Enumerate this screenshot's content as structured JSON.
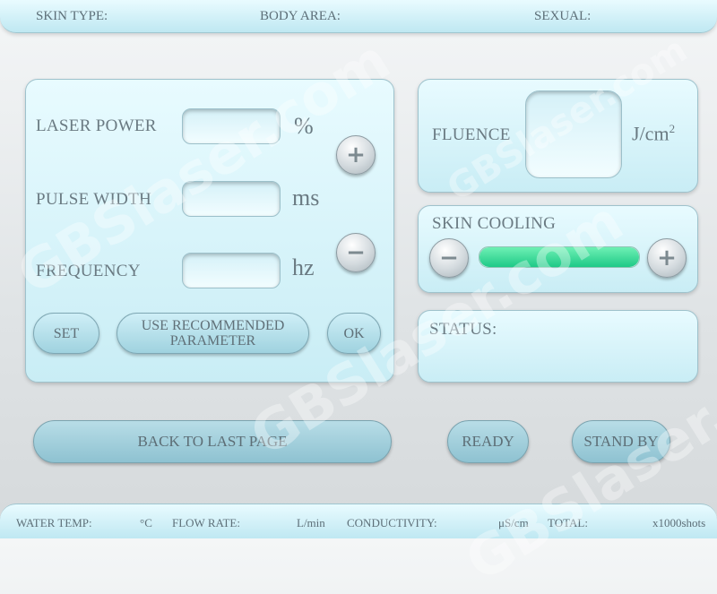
{
  "header": {
    "skin_type": "SKIN TYPE:",
    "body_area": "BODY AREA:",
    "sexual": "SEXUAL:"
  },
  "laser_panel": {
    "laser_power_label": "LASER POWER",
    "laser_power_unit": "%",
    "pulse_width_label": "PULSE  WIDTH",
    "pulse_width_unit": "ms",
    "frequency_label": "FREQUENCY",
    "frequency_unit": "hz",
    "plus_symbol": "+",
    "minus_symbol": "−",
    "set_label": "SET",
    "recommended_label": "USE  RECOMMENDED PARAMETER",
    "ok_label": "OK"
  },
  "fluence": {
    "label": "FLUENCE",
    "unit": "J/cm",
    "unit_exp": "2"
  },
  "skin_cooling": {
    "label": "SKIN COOLING",
    "minus_symbol": "−",
    "plus_symbol": "+",
    "level": 1.0
  },
  "status": {
    "label": "STATUS:"
  },
  "actions": {
    "back_label": "BACK TO LAST PAGE",
    "ready_label": "READY",
    "standby_label": "STAND BY"
  },
  "footer": {
    "water_temp": "WATER TEMP:",
    "water_temp_unit": "°C",
    "flow_rate": "FLOW RATE:",
    "flow_rate_unit": "L/min",
    "conductivity": "CONDUCTIVITY:",
    "conductivity_unit": "μS/cm",
    "total": "TOTAL:",
    "total_unit": "x1000shots"
  },
  "watermark": "GBSlaser.com",
  "colors": {
    "panel": "#d9f4fa",
    "cooling_fill": "#2fd894",
    "text": "#6a7a82"
  }
}
